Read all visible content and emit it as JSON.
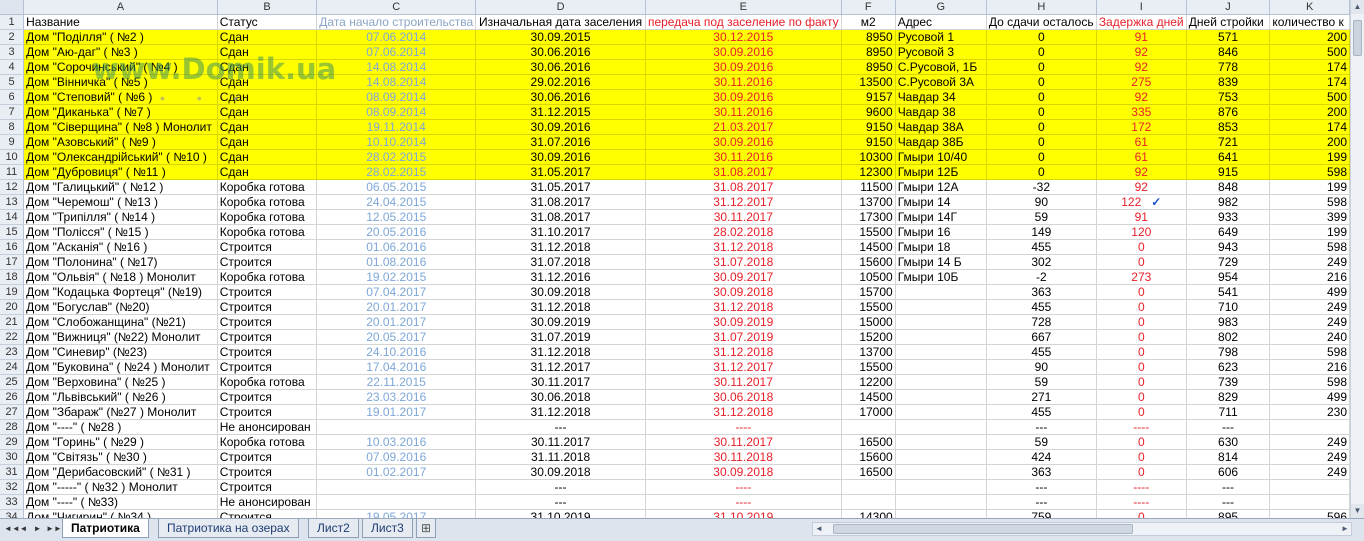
{
  "columns": [
    "A",
    "B",
    "C",
    "D",
    "E",
    "F",
    "G",
    "H",
    "I",
    "J",
    "K"
  ],
  "headers": [
    "Название",
    "Статус",
    "Дата начало строительства",
    "Изначальная дата заселения",
    "передача под заселение по факту",
    "м2",
    "Адрес",
    "До сдачи осталось",
    "Задержка дней",
    "Дней стройки",
    "количество к"
  ],
  "rows": [
    [
      "Дом \"Поділля\" ( №2 )",
      "Сдан",
      "07.06.2014",
      "30.09.2015",
      "30.12.2015",
      "8950",
      "Русовой 1",
      "0",
      "91",
      "571",
      "200"
    ],
    [
      "Дом \"Аю-даг\" ( №3 )",
      "Сдан",
      "07.06.2014",
      "30.06.2016",
      "30.09.2016",
      "8950",
      "Русовой 3",
      "0",
      "92",
      "846",
      "500"
    ],
    [
      "Дом \"Сорочинський\" ( №4 )",
      "Сдан",
      "14.08.2014",
      "30.06.2016",
      "30.09.2016",
      "8950",
      "С.Русовой, 1Б",
      "0",
      "92",
      "778",
      "174"
    ],
    [
      "Дом \"Вінничка\" ( №5 )",
      "Сдан",
      "14.08.2014",
      "29.02.2016",
      "30.11.2016",
      "13500",
      "С.Русовой 3А",
      "0",
      "275",
      "839",
      "174"
    ],
    [
      "Дом \"Степовий\" ( №6 )",
      "Сдан",
      "08.09.2014",
      "30.06.2016",
      "30.09.2016",
      "9157",
      "Чавдар 34",
      "0",
      "92",
      "753",
      "500"
    ],
    [
      "Дом \"Диканька\" ( №7 )",
      "Сдан",
      "08.09.2014",
      "31.12.2015",
      "30.11.2016",
      "9600",
      "Чавдар 38",
      "0",
      "335",
      "876",
      "200"
    ],
    [
      "Дом \"Сіверщина\" ( №8 ) Монолит",
      "Сдан",
      "19.11.2014",
      "30.09.2016",
      "21.03.2017",
      "9150",
      "Чавдар 38А",
      "0",
      "172",
      "853",
      "174"
    ],
    [
      "Дом \"Азовський\" ( №9 )",
      "Сдан",
      "10.10.2014",
      "31.07.2016",
      "30.09.2016",
      "9150",
      "Чавдар 38Б",
      "0",
      "61",
      "721",
      "200"
    ],
    [
      "Дом \"Олександрійський\" ( №10 )",
      "Сдан",
      "28.02.2015",
      "30.09.2016",
      "30.11.2016",
      "10300",
      "Гмыри 10/40",
      "0",
      "61",
      "641",
      "199"
    ],
    [
      "Дом \"Дубровиця\" ( №11 )",
      "Сдан",
      "28.02.2015",
      "31.05.2017",
      "31.08.2017",
      "12300",
      "Гмыри 12Б",
      "0",
      "92",
      "915",
      "598"
    ],
    [
      "Дом \"Галицький\" ( №12 )",
      "Коробка готова",
      "06.05.2015",
      "31.05.2017",
      "31.08.2017",
      "11500",
      "Гмыри 12А",
      "-32",
      "92",
      "848",
      "199"
    ],
    [
      "Дом \"Черемош\" ( №13 )",
      "Коробка готова",
      "24.04.2015",
      "31.08.2017",
      "31.12.2017",
      "13700",
      "Гмыри 14",
      "90",
      "122",
      "982",
      "598"
    ],
    [
      "Дом \"Трипілля\" ( №14 )",
      "Коробка готова",
      "12.05.2015",
      "31.08.2017",
      "30.11.2017",
      "17300",
      "Гмыри 14Г",
      "59",
      "91",
      "933",
      "399"
    ],
    [
      "Дом \"Полісся\" ( №15 )",
      "Коробка готова",
      "20.05.2016",
      "31.10.2017",
      "28.02.2018",
      "15500",
      "Гмыри 16",
      "149",
      "120",
      "649",
      "199"
    ],
    [
      "Дом \"Асканія\" ( №16 )",
      "Строится",
      "01.06.2016",
      "31.12.2018",
      "31.12.2018",
      "14500",
      "Гмыри 18",
      "455",
      "0",
      "943",
      "598"
    ],
    [
      "Дом \"Полонина\" ( №17)",
      "Строится",
      "01.08.2016",
      "31.07.2018",
      "31.07.2018",
      "15600",
      "Гмыри 14 Б",
      "302",
      "0",
      "729",
      "249"
    ],
    [
      "Дом \"Ольвія\" ( №18 ) Монолит",
      "Коробка готова",
      "19.02.2015",
      "31.12.2016",
      "30.09.2017",
      "10500",
      "Гмыри 10Б",
      "-2",
      "273",
      "954",
      "216"
    ],
    [
      "Дом \"Кодацька Фортеця\" (№19)",
      "Строится",
      "07.04.2017",
      "30.09.2018",
      "30.09.2018",
      "15700",
      "",
      "363",
      "0",
      "541",
      "499"
    ],
    [
      "Дом \"Богуслав\" (№20)",
      "Строится",
      "20.01.2017",
      "31.12.2018",
      "31.12.2018",
      "15500",
      "",
      "455",
      "0",
      "710",
      "249"
    ],
    [
      "Дом \"Слобожанщина\" (№21)",
      "Строится",
      "20.01.2017",
      "30.09.2019",
      "30.09.2019",
      "15000",
      "",
      "728",
      "0",
      "983",
      "249"
    ],
    [
      "Дом \"Вижниця\" (№22) Монолит",
      "Строится",
      "20.05.2017",
      "31.07.2019",
      "31.07.2019",
      "15200",
      "",
      "667",
      "0",
      "802",
      "240"
    ],
    [
      "Дом \"Синевир\" (№23)",
      "Строится",
      "24.10.2016",
      "31.12.2018",
      "31.12.2018",
      "13700",
      "",
      "455",
      "0",
      "798",
      "598"
    ],
    [
      "Дом \"Буковина\" ( №24 ) Монолит",
      "Строится",
      "17.04.2016",
      "31.12.2017",
      "31.12.2017",
      "15500",
      "",
      "90",
      "0",
      "623",
      "216"
    ],
    [
      "Дом \"Верховина\" ( №25 )",
      "Коробка готова",
      "22.11.2015",
      "30.11.2017",
      "30.11.2017",
      "12200",
      "",
      "59",
      "0",
      "739",
      "598"
    ],
    [
      "Дом \"Львівський\" ( №26 )",
      "Строится",
      "23.03.2016",
      "30.06.2018",
      "30.06.2018",
      "14500",
      "",
      "271",
      "0",
      "829",
      "499"
    ],
    [
      "Дом \"Збараж\" (№27 ) Монолит",
      "Строится",
      "19.01.2017",
      "31.12.2018",
      "31.12.2018",
      "17000",
      "",
      "455",
      "0",
      "711",
      "230"
    ],
    [
      "Дом \"----\" ( №28 )",
      "Не анонсирован",
      "",
      "---",
      "----",
      "",
      "",
      "---",
      "----",
      "---",
      ""
    ],
    [
      "Дом \"Горинь\" ( №29 )",
      "Коробка готова",
      "10.03.2016",
      "30.11.2017",
      "30.11.2017",
      "16500",
      "",
      "59",
      "0",
      "630",
      "249"
    ],
    [
      "Дом \"Світязь\" ( №30 )",
      "Строится",
      "07.09.2016",
      "31.11.2018",
      "30.11.2018",
      "15600",
      "",
      "424",
      "0",
      "814",
      "249"
    ],
    [
      "Дом \"Дерибасовский\" ( №31 )",
      "Строится",
      "01.02.2017",
      "30.09.2018",
      "30.09.2018",
      "16500",
      "",
      "363",
      "0",
      "606",
      "249"
    ],
    [
      "Дом \"-----\" ( №32 ) Монолит",
      "Строится",
      "",
      "---",
      "----",
      "",
      "",
      "---",
      "----",
      "---",
      ""
    ],
    [
      "Дом \"----\" ( №33)",
      "Не анонсирован",
      "",
      "---",
      "----",
      "",
      "",
      "---",
      "----",
      "---",
      ""
    ],
    [
      "Дом \"Чигирин\" ( №34 )",
      "Строится",
      "19.05.2017",
      "31.10.2019",
      "31.10.2019",
      "14300",
      "",
      "759",
      "0",
      "895",
      "596"
    ]
  ],
  "sheet_tabs": [
    "Патриотика",
    "Патриотика на озерах",
    "Лист2",
    "Лист3"
  ],
  "active_tab": "Патриотика",
  "watermark_text": "www.Domik.ua",
  "checkmark": "✓",
  "nav_icons": [
    "◄◄",
    "◄",
    "►",
    "►►"
  ],
  "colors": {
    "highlight": "#ffff00",
    "date_blue": "#7ea7d8",
    "accent_red": "#e8202a"
  }
}
